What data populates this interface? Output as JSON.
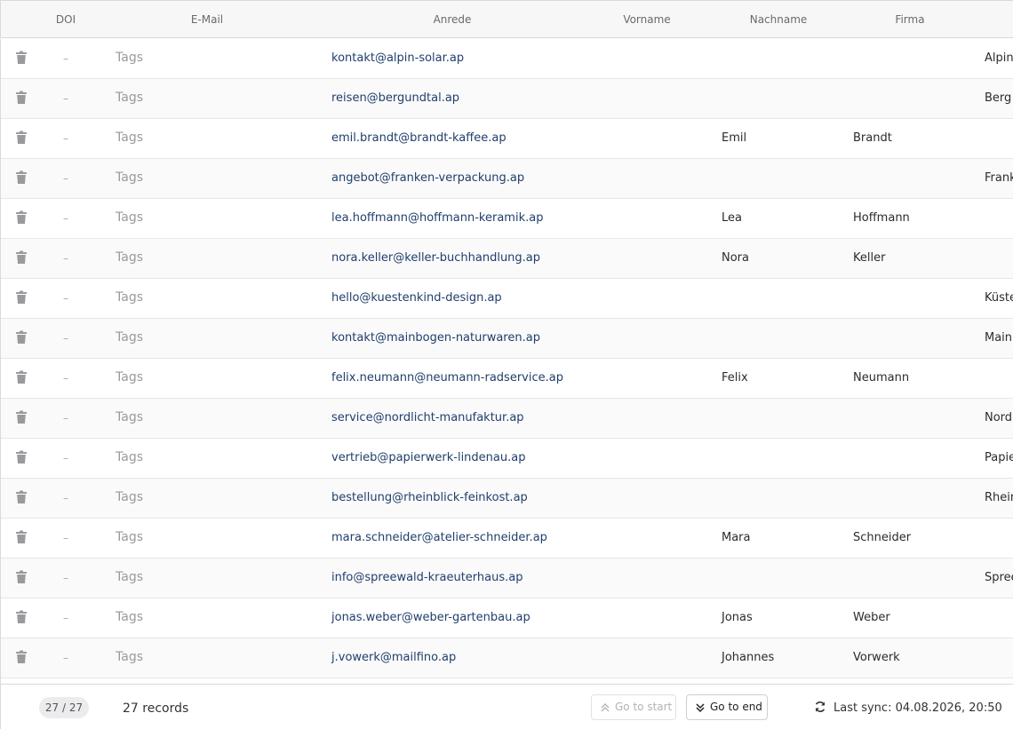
{
  "columns": [
    {
      "key": "doi",
      "label": "DOI"
    },
    {
      "key": "email",
      "label": "E-Mail"
    },
    {
      "key": "anrede",
      "label": "Anrede"
    },
    {
      "key": "vorname",
      "label": "Vorname"
    },
    {
      "key": "nachname",
      "label": "Nachname"
    },
    {
      "key": "firma",
      "label": "Firma"
    }
  ],
  "row_placeholders": {
    "doi": "–",
    "tags": "Tags",
    "delete_icon": "trash-icon"
  },
  "rows": [
    {
      "email": "kontakt@alpin-solar.ap",
      "first": "",
      "last": "",
      "company": "Alpin"
    },
    {
      "email": "reisen@bergundtal.ap",
      "first": "",
      "last": "",
      "company": "Berg"
    },
    {
      "email": "emil.brandt@brandt-kaffee.ap",
      "first": "Emil",
      "last": "Brandt",
      "company": ""
    },
    {
      "email": "angebot@franken-verpackung.ap",
      "first": "",
      "last": "",
      "company": "Frank"
    },
    {
      "email": "lea.hoffmann@hoffmann-keramik.ap",
      "first": "Lea",
      "last": "Hoffmann",
      "company": ""
    },
    {
      "email": "nora.keller@keller-buchhandlung.ap",
      "first": "Nora",
      "last": "Keller",
      "company": ""
    },
    {
      "email": "hello@kuestenkind-design.ap",
      "first": "",
      "last": "",
      "company": "Küste"
    },
    {
      "email": "kontakt@mainbogen-naturwaren.ap",
      "first": "",
      "last": "",
      "company": "Mainl"
    },
    {
      "email": "felix.neumann@neumann-radservice.ap",
      "first": "Felix",
      "last": "Neumann",
      "company": ""
    },
    {
      "email": "service@nordlicht-manufaktur.ap",
      "first": "",
      "last": "",
      "company": "Nord"
    },
    {
      "email": "vertrieb@papierwerk-lindenau.ap",
      "first": "",
      "last": "",
      "company": "Papie"
    },
    {
      "email": "bestellung@rheinblick-feinkost.ap",
      "first": "",
      "last": "",
      "company": "Rhein"
    },
    {
      "email": "mara.schneider@atelier-schneider.ap",
      "first": "Mara",
      "last": "Schneider",
      "company": ""
    },
    {
      "email": "info@spreewald-kraeuterhaus.ap",
      "first": "",
      "last": "",
      "company": "Spree"
    },
    {
      "email": "jonas.weber@weber-gartenbau.ap",
      "first": "Jonas",
      "last": "Weber",
      "company": ""
    },
    {
      "email": "j.vowerk@mailfino.ap",
      "first": "Johannes",
      "last": "Vorwerk",
      "company": ""
    }
  ],
  "footer": {
    "page_count": "27 / 27",
    "records": "27 records",
    "go_to_start": "Go to start",
    "go_to_end": "Go to end",
    "last_sync": "Last sync: 04.08.2026, 20:50"
  },
  "colors": {
    "email_text": "#1f3f6b",
    "header_bg": "#f7f7f8"
  }
}
